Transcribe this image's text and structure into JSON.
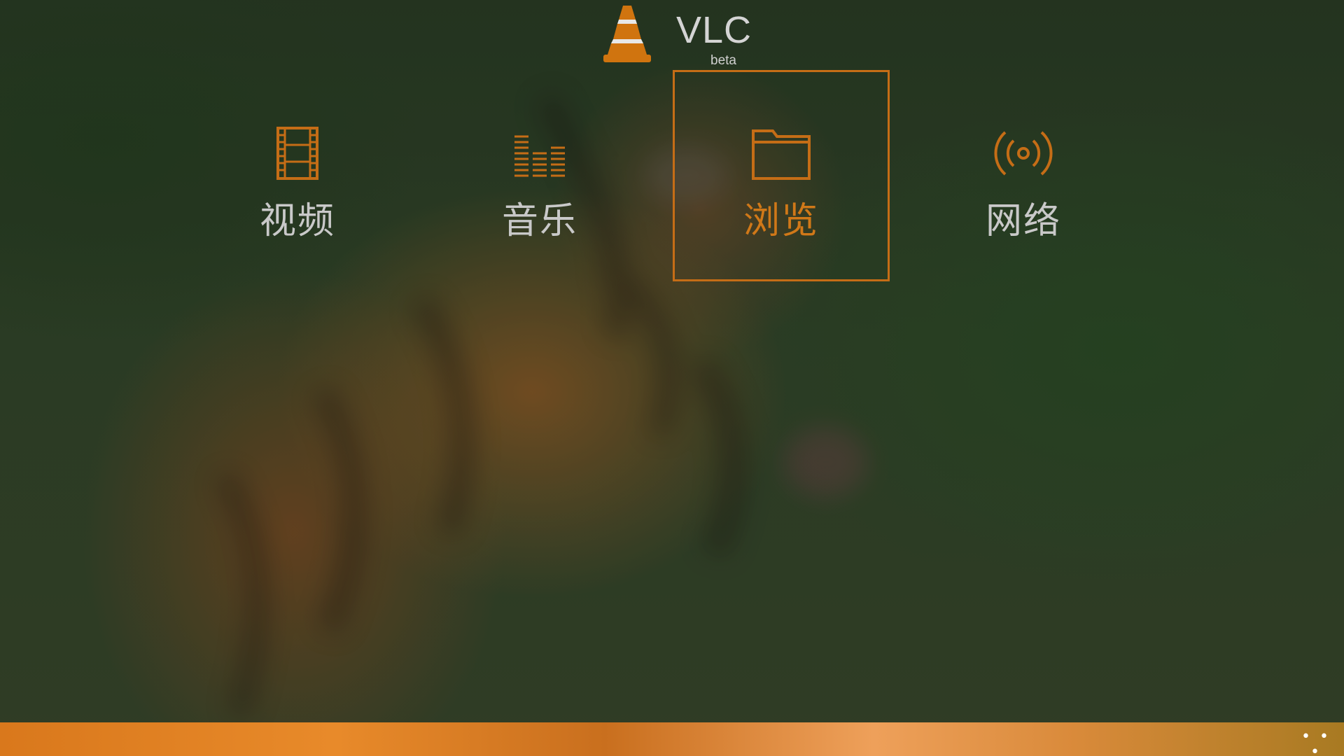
{
  "app": {
    "title": "VLC",
    "subtitle": "beta",
    "accent_color": "#c56d16",
    "logo_icon": "vlc-cone-icon"
  },
  "nav": {
    "items": [
      {
        "label": "视频",
        "icon": "film-icon",
        "selected": false
      },
      {
        "label": "音乐",
        "icon": "equalizer-icon",
        "selected": false
      },
      {
        "label": "浏览",
        "icon": "folder-icon",
        "selected": true
      },
      {
        "label": "网络",
        "icon": "broadcast-icon",
        "selected": false
      }
    ]
  },
  "appbar": {
    "more_label": "• • •",
    "more_icon": "ellipsis-icon",
    "color": "#e88a2a"
  }
}
